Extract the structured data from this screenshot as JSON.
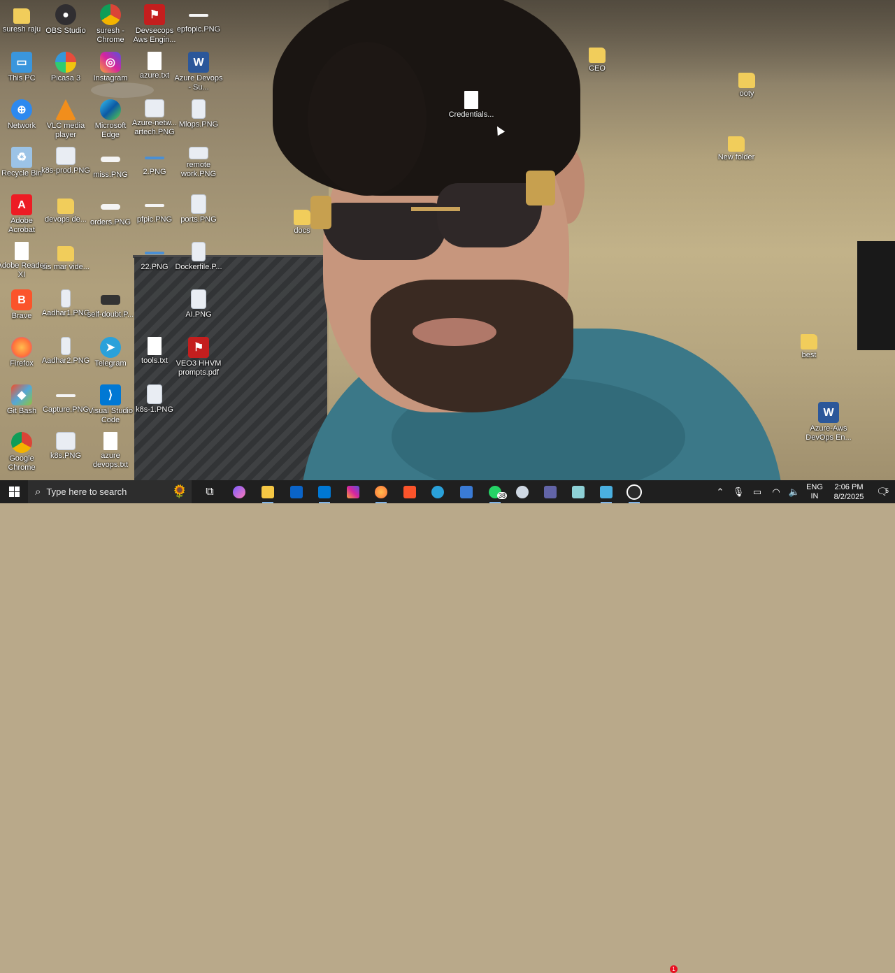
{
  "desktop_icons": [
    {
      "id": "suresh-raju",
      "label": "suresh raju",
      "icon": "user-folder-icon"
    },
    {
      "id": "obs-studio",
      "label": "OBS Studio",
      "icon": "obs-icon"
    },
    {
      "id": "suresh-chrome",
      "label": "suresh - Chrome",
      "icon": "chrome-icon"
    },
    {
      "id": "devsecops-pdf",
      "label": "Devsecops Aws Engin...",
      "icon": "pdf-icon"
    },
    {
      "id": "epfopic",
      "label": "epfopic.PNG",
      "icon": "image-file-icon"
    },
    {
      "id": "this-pc",
      "label": "This PC",
      "icon": "computer-icon"
    },
    {
      "id": "picasa",
      "label": "Picasa 3",
      "icon": "picasa-icon"
    },
    {
      "id": "instagram",
      "label": "Instagram",
      "icon": "instagram-icon"
    },
    {
      "id": "azure-txt",
      "label": "azure.txt",
      "icon": "text-file-icon"
    },
    {
      "id": "azure-devops-su",
      "label": "Azure Devops - Su...",
      "icon": "word-doc-icon"
    },
    {
      "id": "network",
      "label": "Network",
      "icon": "network-icon"
    },
    {
      "id": "vlc",
      "label": "VLC media player",
      "icon": "vlc-icon"
    },
    {
      "id": "edge",
      "label": "Microsoft Edge",
      "icon": "edge-icon"
    },
    {
      "id": "azure-netw",
      "label": "Azure-netw... artech.PNG",
      "icon": "image-file-icon"
    },
    {
      "id": "mlops",
      "label": "Mlops.PNG",
      "icon": "image-file-icon"
    },
    {
      "id": "recycle-bin",
      "label": "Recycle Bin",
      "icon": "recycle-bin-icon"
    },
    {
      "id": "k8s-prod",
      "label": "k8s-prod.PNG",
      "icon": "image-file-icon"
    },
    {
      "id": "miss",
      "label": "miss.PNG",
      "icon": "image-file-icon"
    },
    {
      "id": "two-png",
      "label": "2.PNG",
      "icon": "image-file-icon"
    },
    {
      "id": "remote-work",
      "label": "remote work.PNG",
      "icon": "image-file-icon"
    },
    {
      "id": "adobe-acrobat",
      "label": "Adobe Acrobat",
      "icon": "acrobat-icon"
    },
    {
      "id": "devops-de",
      "label": "devops de...",
      "icon": "folder-icon"
    },
    {
      "id": "orders",
      "label": "orders.PNG",
      "icon": "image-file-icon"
    },
    {
      "id": "pfpic",
      "label": "pfpic.PNG",
      "icon": "image-file-icon"
    },
    {
      "id": "ports",
      "label": "ports.PNG",
      "icon": "image-file-icon"
    },
    {
      "id": "adobe-reader",
      "label": "Adobe Reader XI",
      "icon": "reader-icon"
    },
    {
      "id": "sis-mar-vide",
      "label": "sis mar vide...",
      "icon": "folder-icon"
    },
    {
      "id": "twentytwo-png",
      "label": "22.PNG",
      "icon": "image-file-icon"
    },
    {
      "id": "dockerfile",
      "label": "Dockerfile.P...",
      "icon": "image-file-icon"
    },
    {
      "id": "brave",
      "label": "Brave",
      "icon": "brave-icon"
    },
    {
      "id": "aadhar1",
      "label": "Aadhar1.PNG",
      "icon": "image-file-icon"
    },
    {
      "id": "self-doubt",
      "label": "self-doubt.P...",
      "icon": "image-file-icon"
    },
    {
      "id": "ai-png",
      "label": "AI.PNG",
      "icon": "image-file-icon"
    },
    {
      "id": "firefox",
      "label": "Firefox",
      "icon": "firefox-icon"
    },
    {
      "id": "aadhar2",
      "label": "Aadhar2.PNG",
      "icon": "image-file-icon"
    },
    {
      "id": "telegram",
      "label": "Telegram",
      "icon": "telegram-icon"
    },
    {
      "id": "tools-txt",
      "label": "tools.txt",
      "icon": "text-file-icon"
    },
    {
      "id": "veo3-pdf",
      "label": "VEO3 HHVM prompts.pdf",
      "icon": "pdf-icon"
    },
    {
      "id": "git-bash",
      "label": "Git Bash",
      "icon": "git-icon"
    },
    {
      "id": "capture",
      "label": "Capture.PNG",
      "icon": "image-file-icon"
    },
    {
      "id": "vscode",
      "label": "Visual Studio Code",
      "icon": "vscode-icon"
    },
    {
      "id": "k8s-1",
      "label": "k8s-1.PNG",
      "icon": "image-file-icon"
    },
    {
      "id": "google-chrome",
      "label": "Google Chrome",
      "icon": "chrome-icon"
    },
    {
      "id": "k8s-png",
      "label": "k8s.PNG",
      "icon": "image-file-icon"
    },
    {
      "id": "azure-devops-txt",
      "label": "azure devops.txt",
      "icon": "text-file-icon"
    },
    {
      "id": "docs",
      "label": "docs",
      "icon": "folder-icon"
    },
    {
      "id": "credentials",
      "label": "Credentials...",
      "icon": "text-file-icon"
    },
    {
      "id": "ceo",
      "label": "CEO",
      "icon": "folder-icon"
    },
    {
      "id": "ooty",
      "label": "ooty",
      "icon": "folder-icon"
    },
    {
      "id": "new-folder",
      "label": "New folder",
      "icon": "folder-icon"
    },
    {
      "id": "best",
      "label": "best",
      "icon": "folder-icon"
    },
    {
      "id": "azure-aws-devops",
      "label": "Azure-Aws DevOps En...",
      "icon": "word-doc-icon"
    }
  ],
  "taskbar": {
    "search_placeholder": "Type here to search",
    "apps": [
      "task-view-icon",
      "copilot-icon",
      "file-explorer-icon",
      "outlook-icon",
      "vscode-icon",
      "instagram-icon",
      "firefox-icon",
      "brave-icon",
      "telegram-icon",
      "remote-desktop-icon",
      "whatsapp-icon",
      "paint-icon",
      "teams-icon",
      "notepad-icon",
      "photos-icon",
      "snipping-icon"
    ],
    "whatsapp_badge": "38",
    "notification_badge": "1",
    "language_line1": "ENG",
    "language_line2": "IN",
    "time": "2:06 PM",
    "date": "8/2/2025",
    "notification_count": "5"
  }
}
